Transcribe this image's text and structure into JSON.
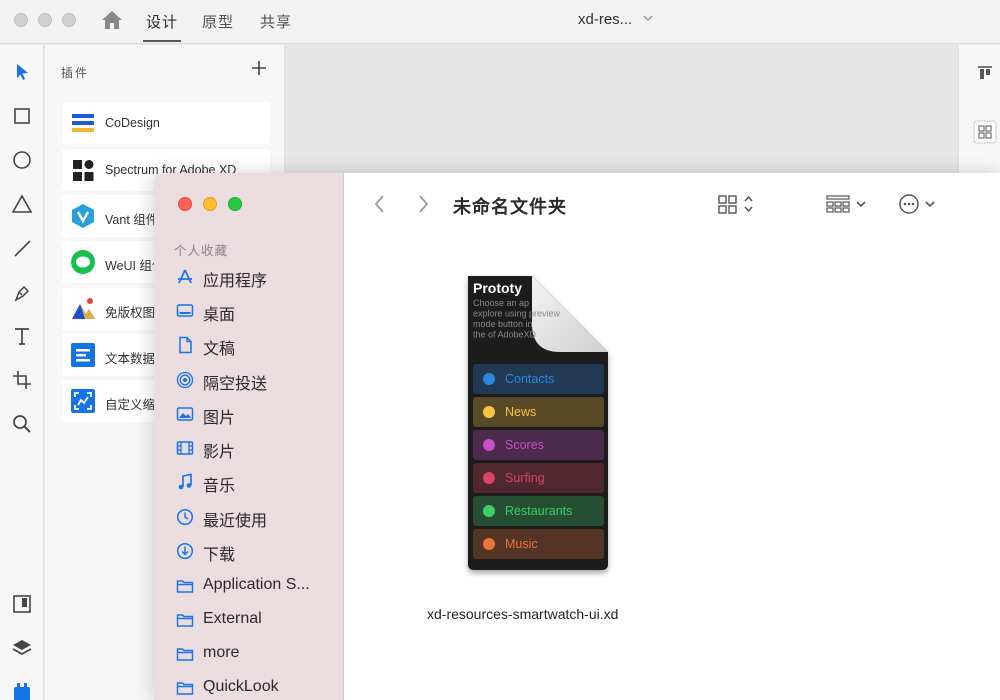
{
  "topbar": {
    "tabs": [
      "设计",
      "原型",
      "共享"
    ],
    "active_tab": "设计",
    "document_title": "xd-res..."
  },
  "plugins_panel": {
    "title": "插件",
    "items": [
      {
        "label": "CoDesign",
        "icon": "codesign-icon"
      },
      {
        "label": "Spectrum for Adobe XD",
        "icon": "spectrum-icon"
      },
      {
        "label": "Vant 组件",
        "icon": "vant-icon"
      },
      {
        "label": "WeUI 组件",
        "icon": "weui-icon"
      },
      {
        "label": "免版权图",
        "icon": "free-image-icon"
      },
      {
        "label": "文本数据",
        "icon": "text-data-icon"
      },
      {
        "label": "自定义缩",
        "icon": "custom-zoom-icon"
      }
    ]
  },
  "finder": {
    "folder_title": "未命名文件夹",
    "section_favorites": "个人收藏",
    "sidebar_items": [
      {
        "label": "应用程序",
        "icon": "applications-icon"
      },
      {
        "label": "桌面",
        "icon": "desktop-icon"
      },
      {
        "label": "文稿",
        "icon": "documents-icon"
      },
      {
        "label": "隔空投送",
        "icon": "airdrop-icon"
      },
      {
        "label": "图片",
        "icon": "pictures-icon"
      },
      {
        "label": "影片",
        "icon": "movies-icon"
      },
      {
        "label": "音乐",
        "icon": "music-icon"
      },
      {
        "label": "最近使用",
        "icon": "recents-icon"
      },
      {
        "label": "下载",
        "icon": "downloads-icon"
      },
      {
        "label": "Application S...",
        "icon": "folder-icon"
      },
      {
        "label": "External",
        "icon": "folder-icon"
      },
      {
        "label": "more",
        "icon": "folder-icon"
      },
      {
        "label": "QuickLook",
        "icon": "folder-icon"
      }
    ],
    "file": {
      "name": "xd-resources-smartwatch-ui.xd",
      "preview_title": "Prototy",
      "preview_text": "Choose an ap explore using preview mode button in the of AdobeXD",
      "preview_rows": [
        {
          "label": "Contacts",
          "color": "#2e86de"
        },
        {
          "label": "News",
          "color": "#f6c343"
        },
        {
          "label": "Scores",
          "color": "#c94fc9"
        },
        {
          "label": "Surfing",
          "color": "#d64560"
        },
        {
          "label": "Restaurants",
          "color": "#3ccf6a"
        },
        {
          "label": "Music",
          "color": "#e7743c"
        }
      ]
    }
  }
}
